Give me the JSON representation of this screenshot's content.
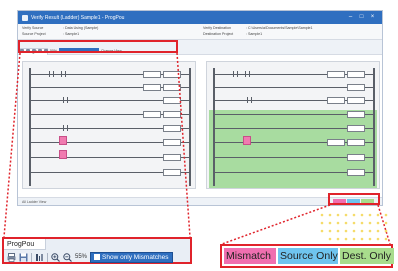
{
  "window": {
    "title": "Verify Result (Ladder) Sample1 - ProgPou",
    "controls": {
      "minimize": "–",
      "maximize": "□",
      "close": "×"
    }
  },
  "info": {
    "verify_source_label": "Verify Source",
    "verify_source_value": ": Data Using (Sample)",
    "source_project_label": "Source Project",
    "source_project_value": ": Sample1",
    "verify_dest_label": "Verify Destination",
    "verify_dest_value": ": C:\\Users\\a\\Documents\\Sample\\Sample1",
    "dest_project_label": "Destination Project",
    "dest_project_value": ": Sample1"
  },
  "tab": {
    "label": "ProgPou"
  },
  "toolbar": {
    "zoom": "55%",
    "show_mismatch": "Show only Mismatches",
    "change_view": "Change View"
  },
  "status": {
    "text": "All Ladder View"
  },
  "callout_toolbar": {
    "tab_label": "ProgPou",
    "zoom_value": "55%",
    "show_mismatch_label": "Show only Mismatches"
  },
  "legend": {
    "mismatch": "Mismatch",
    "source_only": "Source Only",
    "dest_only": "Dest. Only"
  },
  "colors": {
    "mismatch": "#f06fb0",
    "source_only": "#6fc4ef",
    "dest_only": "#a8dc8c",
    "callout": "#e0232b",
    "accent": "#2f6fc0"
  },
  "icons": [
    "print-icon",
    "save-icon",
    "column-icon",
    "zoom-in-icon",
    "zoom-out-icon",
    "checkbox-icon"
  ]
}
